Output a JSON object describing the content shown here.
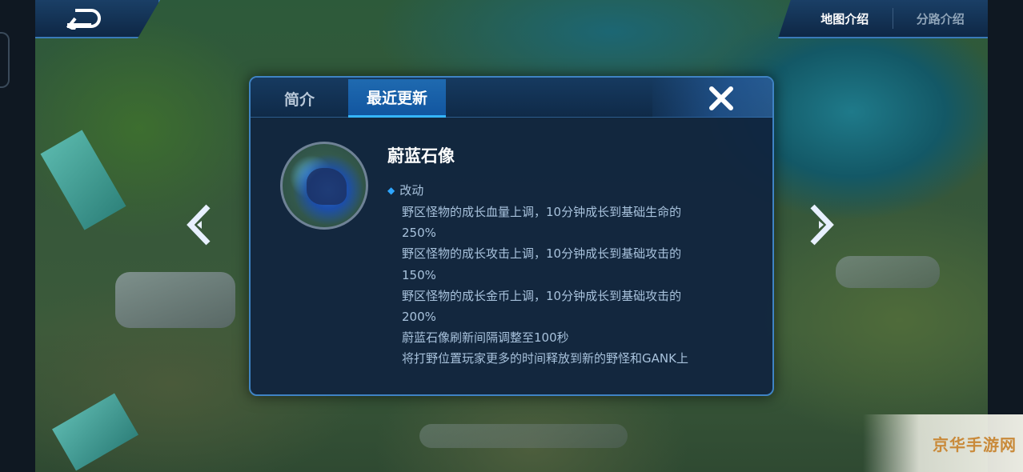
{
  "nav": {
    "back_icon": "return-arrow-icon",
    "top_tabs": [
      {
        "label": "地图介绍",
        "active": true
      },
      {
        "label": "分路介绍",
        "active": false
      }
    ]
  },
  "dialog": {
    "tabs": [
      {
        "label": "简介",
        "active": false
      },
      {
        "label": "最近更新",
        "active": true
      }
    ],
    "close_icon": "close-x-icon",
    "monster_name": "蔚蓝石像",
    "section_title": "改动",
    "lines": [
      "野区怪物的成长血量上调，10分钟成长到基础生命的",
      "250%",
      "野区怪物的成长攻击上调，10分钟成长到基础攻击的",
      "150%",
      "野区怪物的成长金币上调，10分钟成长到基础攻击的",
      "200%",
      "蔚蓝石像刷新间隔调整至100秒",
      "将打野位置玩家更多的时间释放到新的野怪和GANK上"
    ]
  },
  "arrows": {
    "left_icon": "prev-arrow-icon",
    "right_icon": "next-arrow-icon"
  },
  "watermark": "京华手游网",
  "colors": {
    "accent": "#35b6ff",
    "panel": "#10243e",
    "text": "#a8c2dc"
  }
}
